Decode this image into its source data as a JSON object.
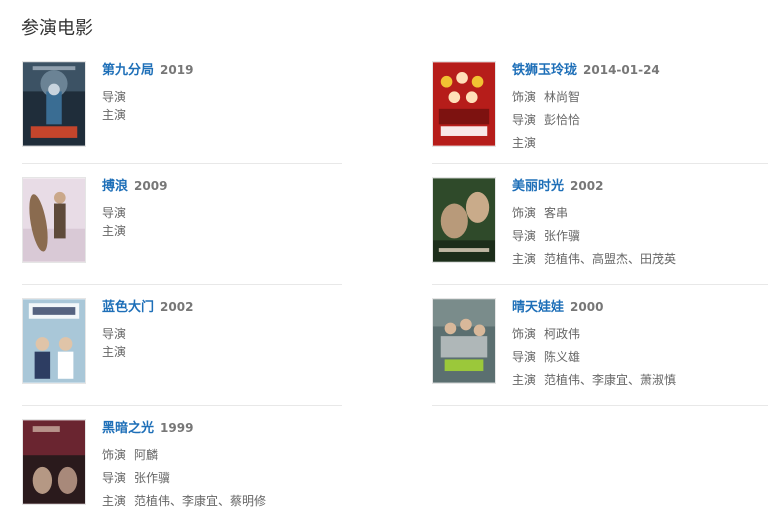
{
  "section": {
    "title": "参演电影"
  },
  "movies": [
    {
      "title": "第九分局",
      "year": "2019",
      "roles": [
        {
          "label": "导演",
          "names": ""
        },
        {
          "label": "主演",
          "names": ""
        }
      ]
    },
    {
      "title": "铁狮玉玲珑",
      "year": "2014-01-24",
      "roles": [
        {
          "label": "饰演",
          "names": "林尚智"
        },
        {
          "label": "导演",
          "names": "彭恰恰"
        },
        {
          "label": "主演",
          "names": ""
        }
      ]
    },
    {
      "title": "搏浪",
      "year": "2009",
      "roles": [
        {
          "label": "导演",
          "names": ""
        },
        {
          "label": "主演",
          "names": ""
        }
      ]
    },
    {
      "title": "美丽时光",
      "year": "2002",
      "roles": [
        {
          "label": "饰演",
          "names": "客串"
        },
        {
          "label": "导演",
          "names": "张作骥"
        },
        {
          "label": "主演",
          "names": "范植伟、高盟杰、田茂英"
        }
      ]
    },
    {
      "title": "蓝色大门",
      "year": "2002",
      "roles": [
        {
          "label": "导演",
          "names": ""
        },
        {
          "label": "主演",
          "names": ""
        }
      ]
    },
    {
      "title": "晴天娃娃",
      "year": "2000",
      "roles": [
        {
          "label": "饰演",
          "names": "柯政伟"
        },
        {
          "label": "导演",
          "names": "陈义雄"
        },
        {
          "label": "主演",
          "names": "范植伟、李康宜、萧淑慎"
        }
      ]
    },
    {
      "title": "黑暗之光",
      "year": "1999",
      "roles": [
        {
          "label": "饰演",
          "names": "阿麟"
        },
        {
          "label": "导演",
          "names": "张作骥"
        },
        {
          "label": "主演",
          "names": "范植伟、李康宜、蔡明修"
        }
      ]
    }
  ],
  "posters": [
    {
      "bg": "#1f2d3a",
      "accent": "#c8d4de",
      "highlight": "#e24a2a",
      "scene": "dark-sky"
    },
    {
      "bg": "#b61d1a",
      "accent": "#f1c232",
      "highlight": "#ffffff",
      "scene": "red-crowd"
    },
    {
      "bg": "#d9c9d6",
      "accent": "#8a6b4f",
      "highlight": "#5e4a3a",
      "scene": "beach"
    },
    {
      "bg": "#2f4a2a",
      "accent": "#b89a7a",
      "highlight": "#e9d8c4",
      "scene": "faces"
    },
    {
      "bg": "#a9c7d8",
      "accent": "#2d3d62",
      "highlight": "#ffffff",
      "scene": "blue-door"
    },
    {
      "bg": "#5b6f70",
      "accent": "#9bc83a",
      "highlight": "#e8e8e8",
      "scene": "group"
    },
    {
      "bg": "#6a2530",
      "accent": "#2a1a1c",
      "highlight": "#d8c0b0",
      "scene": "dark-portrait"
    }
  ]
}
